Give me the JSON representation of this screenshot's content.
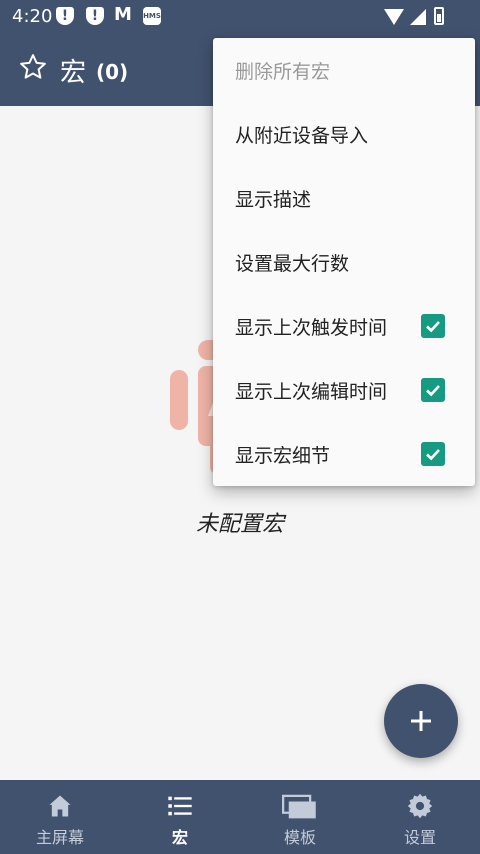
{
  "status_bar": {
    "time": "4:20",
    "hms_label": "HMS"
  },
  "app_bar": {
    "title": "宏",
    "count": "(0)"
  },
  "empty_state": {
    "message": "未配置宏"
  },
  "menu": {
    "items": [
      {
        "label": "删除所有宏",
        "enabled": false
      },
      {
        "label": "从附近设备导入"
      },
      {
        "label": "显示描述"
      },
      {
        "label": "设置最大行数"
      },
      {
        "label": "显示上次触发时间",
        "checked": true
      },
      {
        "label": "显示上次编辑时间",
        "checked": true
      },
      {
        "label": "显示宏细节",
        "checked": true
      }
    ]
  },
  "bottom_nav": {
    "items": [
      {
        "label": "主屏幕",
        "icon": "home-icon"
      },
      {
        "label": "宏",
        "icon": "list-icon",
        "active": true
      },
      {
        "label": "模板",
        "icon": "templates-icon"
      },
      {
        "label": "设置",
        "icon": "gear-icon"
      }
    ]
  },
  "colors": {
    "primary": "#41526f",
    "accent": "#169a82",
    "background": "#f5f5f5"
  }
}
